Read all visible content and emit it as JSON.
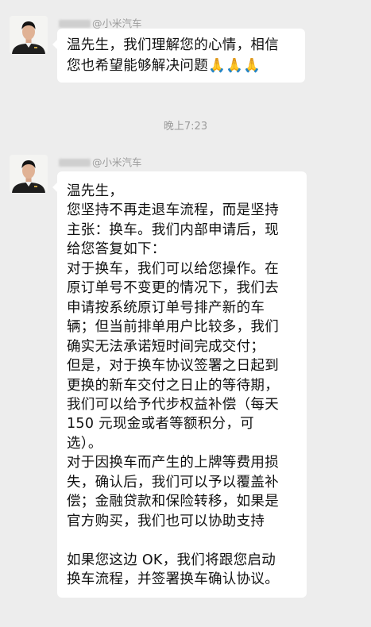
{
  "messages": [
    {
      "sender": "@小米汽车",
      "text": "温先生，我们理解您的心情，相信\n您也希望能够解决问题🙏🙏🙏"
    },
    {
      "sender": "@小米汽车",
      "text": "温先生，\n您坚持不再走退车流程，而是坚持\n主张：换车。我们内部申请后，现\n给您答复如下：\n对于换车，我们可以给您操作。在\n原订单号不变更的情况下，我们去\n申请按系统原订单号排产新的车\n辆；但当前排单用户比较多，我们\n确实无法承诺短时间完成交付；\n但是，对于换车协议签署之日起到\n更换的新车交付之日止的等待期，\n我们可以给予代步权益补偿（每天\n150 元现金或者等额积分，可\n选）。\n对于因换车而产生的上牌等费用损\n失，确认后，我们可以予以覆盖补\n偿；金融贷款和保险转移，如果是\n官方购买，我们也可以协助支持\n\n如果您这边 OK，我们将跟您启动\n换车流程，并签署换车确认协议。"
    }
  ],
  "time_divider": "晚上7:23"
}
